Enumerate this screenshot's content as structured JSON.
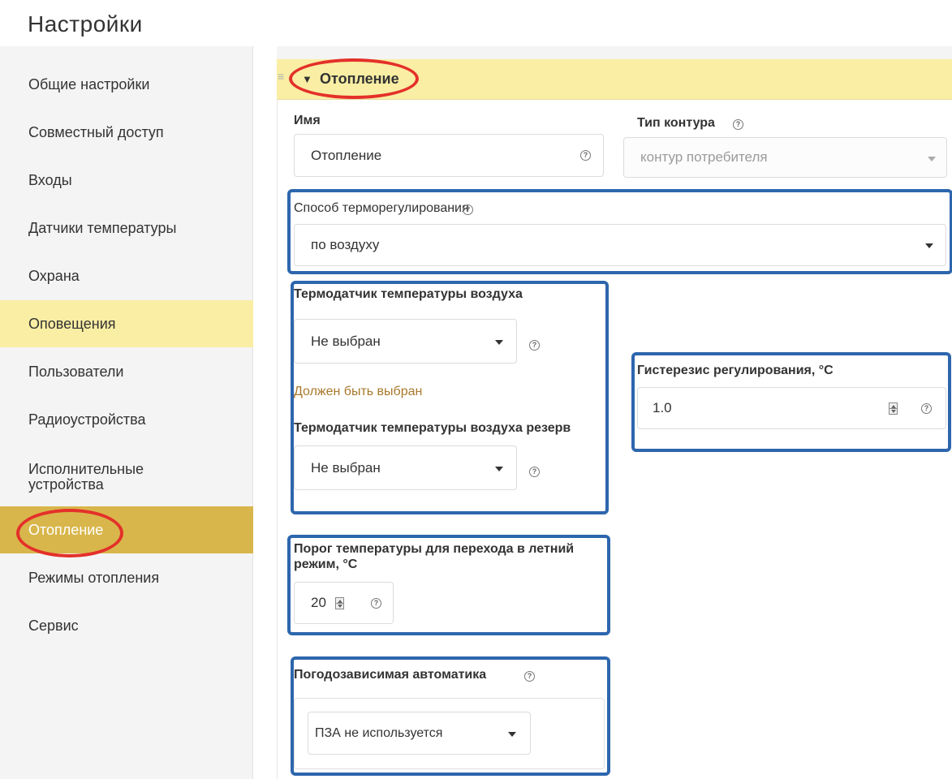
{
  "page": {
    "title": "Настройки"
  },
  "sidebar": {
    "items": [
      {
        "label": "Общие настройки"
      },
      {
        "label": "Совместный доступ"
      },
      {
        "label": "Входы"
      },
      {
        "label": "Датчики температуры"
      },
      {
        "label": "Охрана"
      },
      {
        "label": "Оповещения"
      },
      {
        "label": "Пользователи"
      },
      {
        "label": "Радиоустройства"
      },
      {
        "label": "Исполнительные устройства"
      },
      {
        "label": "Отопление"
      },
      {
        "label": "Режимы отопления"
      },
      {
        "label": "Сервис"
      }
    ],
    "highlighted": "Оповещения",
    "active": "Отопление"
  },
  "panel": {
    "title": "Отопление",
    "name": {
      "label": "Имя",
      "value": "Отопление"
    },
    "circuit_type": {
      "label": "Тип контура",
      "value": "контур потребителя"
    },
    "thermoregulation": {
      "label": "Способ терморегулирования",
      "value": "по воздуху"
    },
    "air_sensor": {
      "label": "Термодатчик температуры воздуха",
      "value": "Не выбран",
      "error": "Должен быть выбран"
    },
    "air_sensor_reserve": {
      "label": "Термодатчик температуры воздуха резерв",
      "value": "Не выбран"
    },
    "hysteresis": {
      "label": "Гистерезис регулирования, °C",
      "value": "1.0"
    },
    "summer_threshold": {
      "label_line1": "Порог температуры для перехода в летний",
      "label_line2": "режим, °C",
      "value": "20"
    },
    "weather_automation": {
      "label": "Погодозависимая автоматика",
      "value": "ПЗА не используется"
    }
  },
  "colors": {
    "highlight_yellow": "#f9eea3",
    "active_gold": "#d8b64b",
    "annotation_red": "#e4302a",
    "annotation_blue": "#2d66ad",
    "error_text": "#a8782b"
  }
}
